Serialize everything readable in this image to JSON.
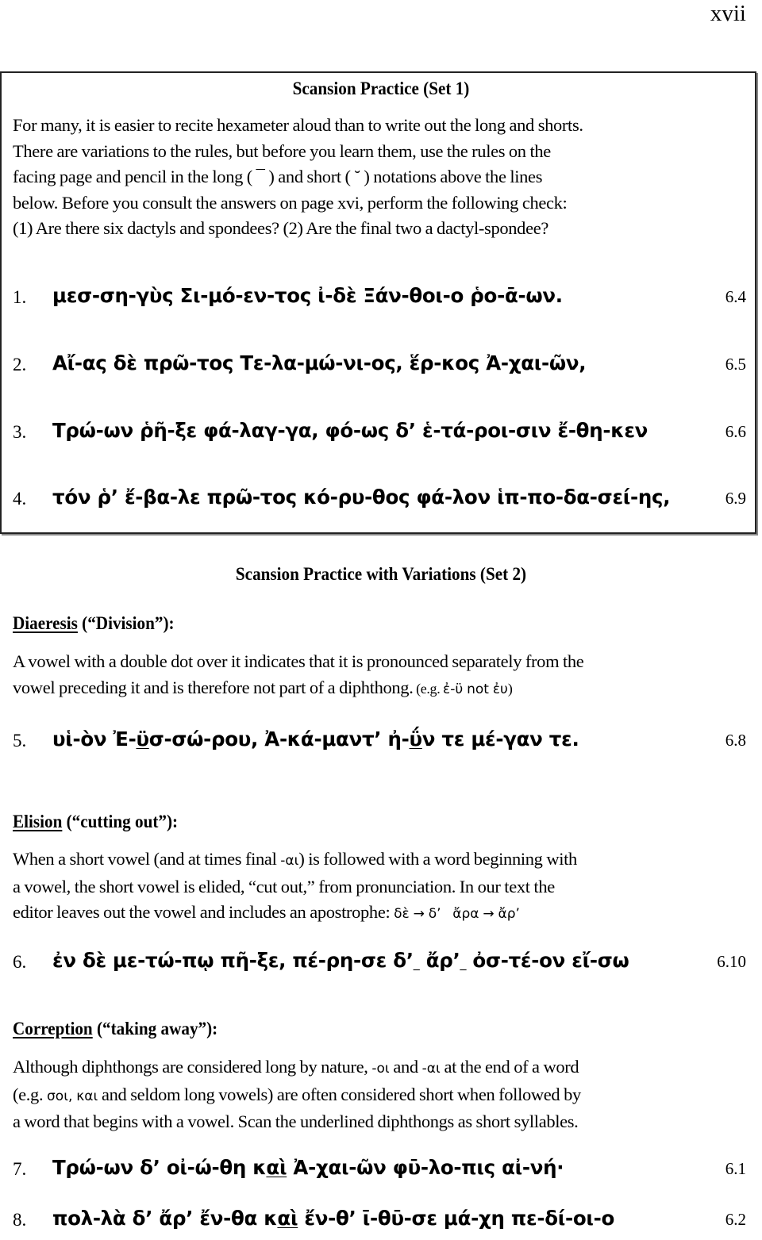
{
  "page_number": "xvii",
  "set1": {
    "title": "Scansion Practice (Set 1)",
    "intro_lines": [
      "For many, it is easier to recite hexameter aloud than to write out the long and shorts.",
      "There are variations to the rules, but before you learn them, use the rules on the",
      "facing page and pencil in the long ( ¯ ) and short ( ˘ ) notations above the lines",
      "below. Before you consult the answers on page xvi, perform the following check:",
      "(1) Are there six dactyls and spondees? (2) Are the final two a dactyl-spondee?"
    ],
    "verses": [
      {
        "number": "1.",
        "text": "μεσ-ση-γὺς Σι-μό-εν-τος ἰ-δὲ Ξάν-θοι-ο ῥο-ᾱ-ων.",
        "ref": "6.4"
      },
      {
        "number": "2.",
        "text": "Αἴ-ας δὲ πρῶ-τος Τε-λα-μώ-νι-ος, ἕρ-κος Ἀ-χαι-ῶν,",
        "ref": "6.5"
      },
      {
        "number": "3.",
        "text": "Τρώ-ων ῥῆ-ξε φά-λαγ-γα, φό-ως δ’ ἑ-τά-ροι-σιν ἔ-θη-κεν",
        "ref": "6.6"
      },
      {
        "number": "4.",
        "text": "τόν ῥ’ ἔ-βα-λε πρῶ-τος κό-ρυ-θος φά-λον ἱπ-πο-δα-σεί-ης,",
        "ref": "6.9"
      }
    ]
  },
  "set2": {
    "title": "Scansion Practice with Variations (Set 2)",
    "diaeresis": {
      "term": "Diaeresis",
      "gloss": " (“Division”):",
      "lines": [
        "A vowel with a double dot over it indicates that it is pronounced separately from the",
        "vowel preceding it and is therefore not part of a diphthong."
      ],
      "example_prefix": " (e.g. ",
      "example_greek": "ἐ-ϋ not ἐυ",
      "example_suffix": ")",
      "verse": {
        "number": "5.",
        "parts": [
          "υἱ-ὸν Ἐ-",
          "ϋ",
          "σ-σώ-ρου, Ἀ-κά-μαντ’ ἠ-",
          "ΰ",
          "ν τε μέ-γαν τε."
        ],
        "ref": "6.8"
      }
    },
    "elision": {
      "term": "Elision",
      "gloss": " (“cutting out”):",
      "line1_prefix": "When a short vowel (and at times final ",
      "line1_greek": "-αι",
      "line1_suffix": ") is followed with a word beginning with",
      "line2": "a vowel, the short vowel is elided, “cut out,” from pronunciation. In our text the",
      "line3_prefix": "editor leaves out the vowel and includes an apostrophe: ",
      "line3_greek": "δὲ → δ’   ἄρα → ἄρ’",
      "verse": {
        "number": "6.",
        "parts": [
          "ἐν δὲ με-τώ-πῳ πῆ-ξε, πέ-ρη-σε δ’",
          "_",
          " ἄρ’",
          "_",
          " ὀσ-τέ-ον εἴ-σω"
        ],
        "ref": "6.10"
      }
    },
    "correption": {
      "term": "Correption",
      "gloss": " (“taking away”):",
      "line1_prefix": "Although diphthongs are considered long by nature, ",
      "line1_greek_a": "-οι",
      "line1_mid": " and ",
      "line1_greek_b": "-αι",
      "line1_suffix": " at the end of a word",
      "line2_prefix": "(e.g. ",
      "line2_greek": "σοι, και",
      "line2_suffix": " and seldom long vowels) are often considered short when followed by",
      "line3": "a word that begins with a vowel. Scan the underlined diphthongs as short syllables.",
      "verses": [
        {
          "number": "7.",
          "parts": [
            "Τρώ-ων δ’ οἰ-ώ-θη κ",
            "αὶ",
            " Ἀ-χαι-ῶν φῡ-λο-πις αἰ-νή·"
          ],
          "ref": "6.1"
        },
        {
          "number": "8.",
          "parts": [
            "πολ-λὰ δ’ ἄρ’ ἔν-θα κ",
            "αὶ",
            " ἔν-θ’ ῑ-θῡ-σε μά-χη πε-δί-οι-ο"
          ],
          "ref": "6.2"
        }
      ]
    }
  }
}
